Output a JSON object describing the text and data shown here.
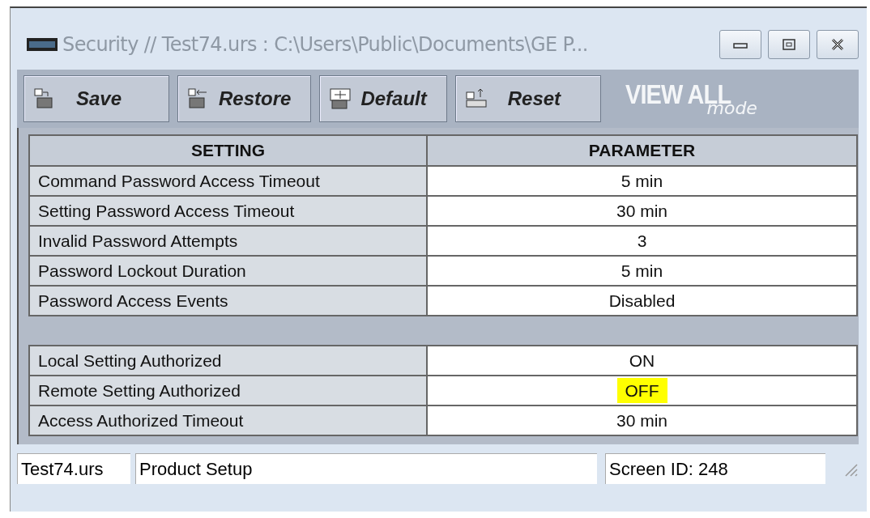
{
  "window": {
    "title": "Security // Test74.urs : C:\\Users\\Public\\Documents\\GE P..."
  },
  "toolbar": {
    "buttons": [
      {
        "label": "Save",
        "kind": "save"
      },
      {
        "label": "Restore",
        "kind": "restore"
      },
      {
        "label": "Default",
        "kind": "default"
      },
      {
        "label": "Reset",
        "kind": "reset"
      }
    ],
    "mode_title": "VIEW ALL",
    "mode_subtitle": "mode"
  },
  "table": {
    "columns": [
      "SETTING",
      "PARAMETER"
    ],
    "rows": [
      {
        "kind": "setting",
        "setting": "Command Password Access Timeout",
        "parameter": "5 min",
        "highlighted": false
      },
      {
        "kind": "setting",
        "setting": "Setting Password Access Timeout",
        "parameter": "30 min",
        "highlighted": false
      },
      {
        "kind": "setting",
        "setting": "Invalid Password Attempts",
        "parameter": "3",
        "highlighted": false
      },
      {
        "kind": "setting",
        "setting": "Password Lockout Duration",
        "parameter": "5 min",
        "highlighted": false
      },
      {
        "kind": "setting",
        "setting": "Password Access Events",
        "parameter": "Disabled",
        "highlighted": false
      },
      {
        "kind": "separator"
      },
      {
        "kind": "setting",
        "setting": "Local Setting Authorized",
        "parameter": "ON",
        "highlighted": false
      },
      {
        "kind": "setting",
        "setting": "Remote Setting Authorized",
        "parameter": "OFF",
        "highlighted": true
      },
      {
        "kind": "setting",
        "setting": "Access Authorized Timeout",
        "parameter": "30 min",
        "highlighted": false
      }
    ]
  },
  "status_bar": {
    "file": "Test74.urs",
    "section": "Product Setup",
    "screen_id": "Screen ID: 248"
  }
}
